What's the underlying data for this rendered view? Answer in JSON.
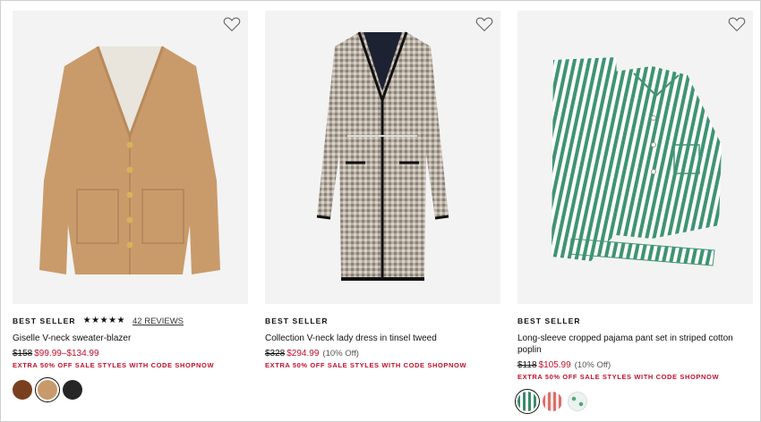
{
  "products": [
    {
      "badge": "BEST SELLER",
      "stars": "★★★★★",
      "reviews": "42 REVIEWS",
      "name": "Giselle V-neck sweater-blazer",
      "was_price": "$158",
      "sale_price": "$99.99–$134.99",
      "promo": "EXTRA 50% OFF SALE STYLES WITH CODE SHOPNOW",
      "swatches": [
        {
          "name": "brown",
          "color": "#7a3f1f"
        },
        {
          "name": "camel",
          "color": "#c89a6b"
        },
        {
          "name": "black",
          "color": "#262626"
        }
      ],
      "selected_swatch": 1
    },
    {
      "badge": "BEST SELLER",
      "name": "Collection V-neck lady dress in tinsel tweed",
      "was_price": "$328",
      "sale_price": "$294.99",
      "discount": "(10% Off)",
      "promo": "EXTRA 50% OFF SALE STYLES WITH CODE SHOPNOW"
    },
    {
      "badge": "BEST SELLER",
      "name": "Long-sleeve cropped pajama pant set in striped cotton poplin",
      "was_price": "$118",
      "sale_price": "$105.99",
      "discount": "(10% Off)",
      "promo": "EXTRA 50% OFF SALE STYLES WITH CODE SHOPNOW",
      "swatches": [
        {
          "name": "green-stripe",
          "color": "#3a8a6a"
        },
        {
          "name": "red-stripe",
          "color": "#d9706a"
        },
        {
          "name": "white-dot",
          "color": "#eaf3ee"
        }
      ],
      "selected_swatch": 0
    }
  ],
  "colors": {
    "sale_red": "#c0102b",
    "image_bg": "#f3f3f3"
  },
  "icons": [
    "heart-icon",
    "star-icon"
  ]
}
